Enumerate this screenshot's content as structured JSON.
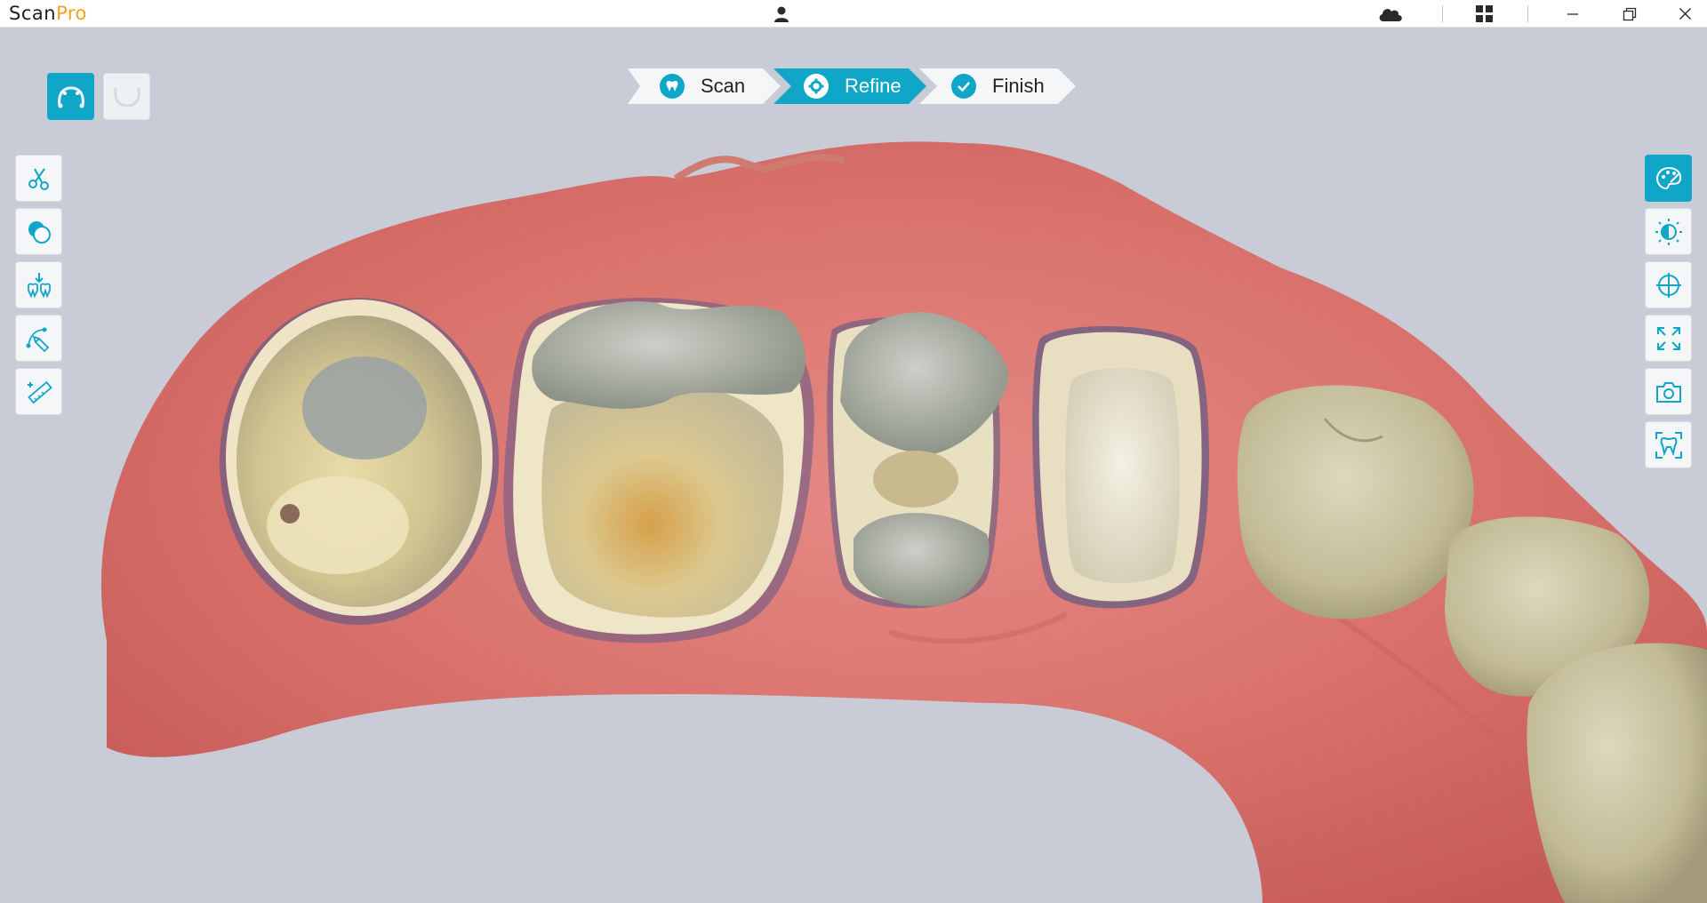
{
  "app": {
    "logo_part1": "Scan",
    "logo_part2": "Pro"
  },
  "titlebar": {
    "icons": [
      "user-icon",
      "cloud-icon",
      "grid-icon",
      "minimize-icon",
      "restore-icon",
      "close-icon"
    ]
  },
  "jaw_selector": {
    "upper": "upper-jaw-icon",
    "lower": "lower-jaw-icon",
    "active": "upper"
  },
  "stepper": {
    "steps": [
      {
        "label": "Scan",
        "icon": "tooth-scan-icon",
        "state": "done"
      },
      {
        "label": "Refine",
        "icon": "gear-icon",
        "state": "active"
      },
      {
        "label": "Finish",
        "icon": "check-icon",
        "state": "pending"
      }
    ]
  },
  "left_tools": [
    "scissors-icon",
    "overlap-icon",
    "occlusion-icon",
    "margin-line-icon",
    "measure-icon"
  ],
  "right_tools": [
    "texture-palette-icon",
    "contrast-icon",
    "crosshair-icon",
    "fit-view-icon",
    "camera-icon",
    "tooth-view-icon"
  ],
  "colors": {
    "accent": "#0fa6c8",
    "logo_accent": "#f0a41f",
    "viewport_bg": "#c9cbd6",
    "gum": "#d8706a",
    "tooth": "#cdc09c"
  }
}
